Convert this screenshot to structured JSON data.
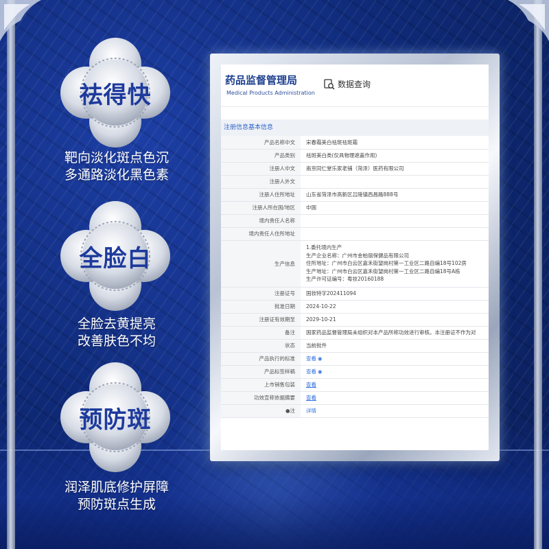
{
  "badges": [
    {
      "title": "祛得快",
      "caption": [
        "靶向淡化斑点色沉",
        "多通路淡化黑色素"
      ]
    },
    {
      "title": "全脸白",
      "caption": [
        "全脸去黄提亮",
        "改善肤色不均"
      ]
    },
    {
      "title": "预防斑",
      "caption": [
        "润泽肌底修护屏障",
        "预防斑点生成"
      ]
    }
  ],
  "document": {
    "org_cn": "药品监督管理局",
    "org_en": "Medical Products Administration",
    "query_label": "数据查询",
    "query_icon": "search-icon",
    "section_title": "注册信息基本信息",
    "rows": [
      {
        "label": "产品名称中文",
        "value": "宋春霜美白祛斑祛斑霜"
      },
      {
        "label": "产品类别",
        "value": "祛斑美白类(仅具物理遮盖作用)"
      },
      {
        "label": "注册人中文",
        "value": "南京同仁堂乐家老铺（菏泽）医药有限公司"
      },
      {
        "label": "注册人外文",
        "value": ""
      },
      {
        "label": "注册人住所地址",
        "value": "山东省菏泽市高新区吕陵镇西昌路888号"
      },
      {
        "label": "注册人所在国/地区",
        "value": "中国"
      },
      {
        "label": "境内责任人名称",
        "value": ""
      },
      {
        "label": "境内责任人住所地址",
        "value": ""
      },
      {
        "label": "生产信息",
        "lines": [
          "1.委托境内生产",
          "生产企业名称：广州市金柏丽保健品有限公司",
          "住所地址：广州市白云区嘉禾街望岗村第一工业区二路自编18号102房",
          "生产地址：广州市白云区嘉禾街望岗村第一工业区二路自编18号A栋",
          "生产许可证编号：粤妆20160188"
        ]
      },
      {
        "label": "注册证号",
        "value": "国妆特字202411094"
      },
      {
        "label": "批准日期",
        "value": "2024-10-22"
      },
      {
        "label": "注册证有效期至",
        "value": "2029-10-21"
      },
      {
        "label": "备注",
        "value": "国家药品监督管理局未组织对本产品所称功效进行审核。本注册证不作为对"
      },
      {
        "label": "状态",
        "value": "当前批件"
      },
      {
        "label": "产品执行的标准",
        "value": "查看",
        "type": "link-eye"
      },
      {
        "label": "产品标签样稿",
        "value": "查看",
        "type": "link-eye"
      },
      {
        "label": "上市销售包装",
        "value": "查看",
        "type": "link-underline"
      },
      {
        "label": "功效宣称依据摘要",
        "value": "查看",
        "type": "link-underline"
      },
      {
        "label": "注",
        "value": "详情",
        "type": "link-plain",
        "label_icon": "pin-icon"
      }
    ]
  },
  "colors": {
    "badge_text": "#1d3a9c",
    "link": "#2f6fe0",
    "org_blue": "#1d3f8f",
    "background": "#0f2a78"
  }
}
